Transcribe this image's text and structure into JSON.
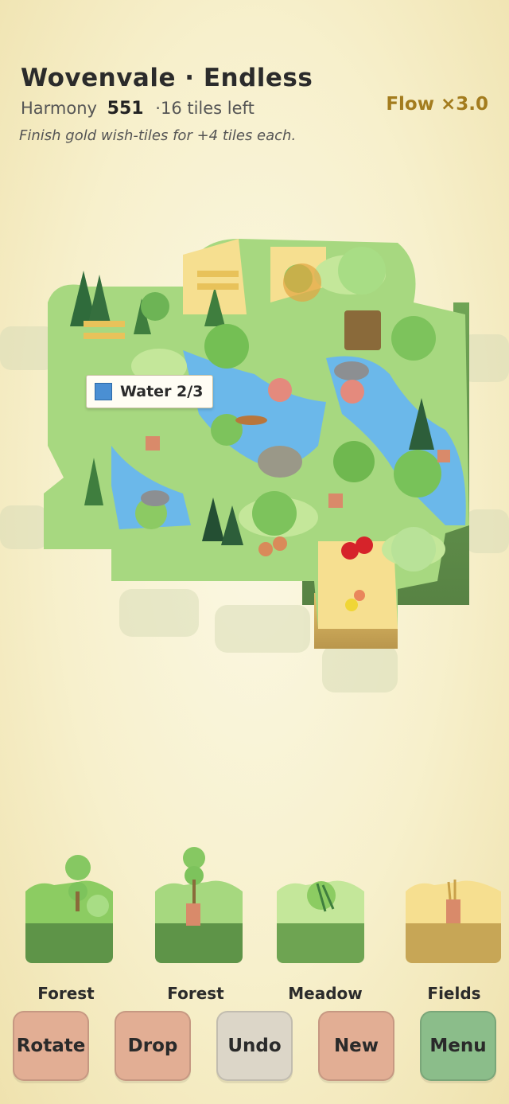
{
  "header": {
    "title": "Wovenvale · Endless",
    "harmony_label": "Harmony",
    "harmony_value": "551",
    "tiles_left": "·16 tiles left",
    "hint": "Finish gold wish-tiles for +4 tiles each.",
    "flow": "Flow ×3.0"
  },
  "board": {
    "tooltip": {
      "label": "Water 2/3",
      "swatch_color": "#4a8fd3"
    }
  },
  "tray": [
    {
      "label": "Forest"
    },
    {
      "label": "Forest"
    },
    {
      "label": "Meadow"
    },
    {
      "label": "Fields"
    }
  ],
  "controls": {
    "rotate": "Rotate",
    "drop": "Drop",
    "undo": "Undo",
    "new": "New",
    "menu": "Menu"
  },
  "colors": {
    "grass": "#9fd77a",
    "meadow": "#c4e79a",
    "water": "#6bb8ea",
    "fields": "#f6df90",
    "flow_text": "#a37c1e"
  }
}
